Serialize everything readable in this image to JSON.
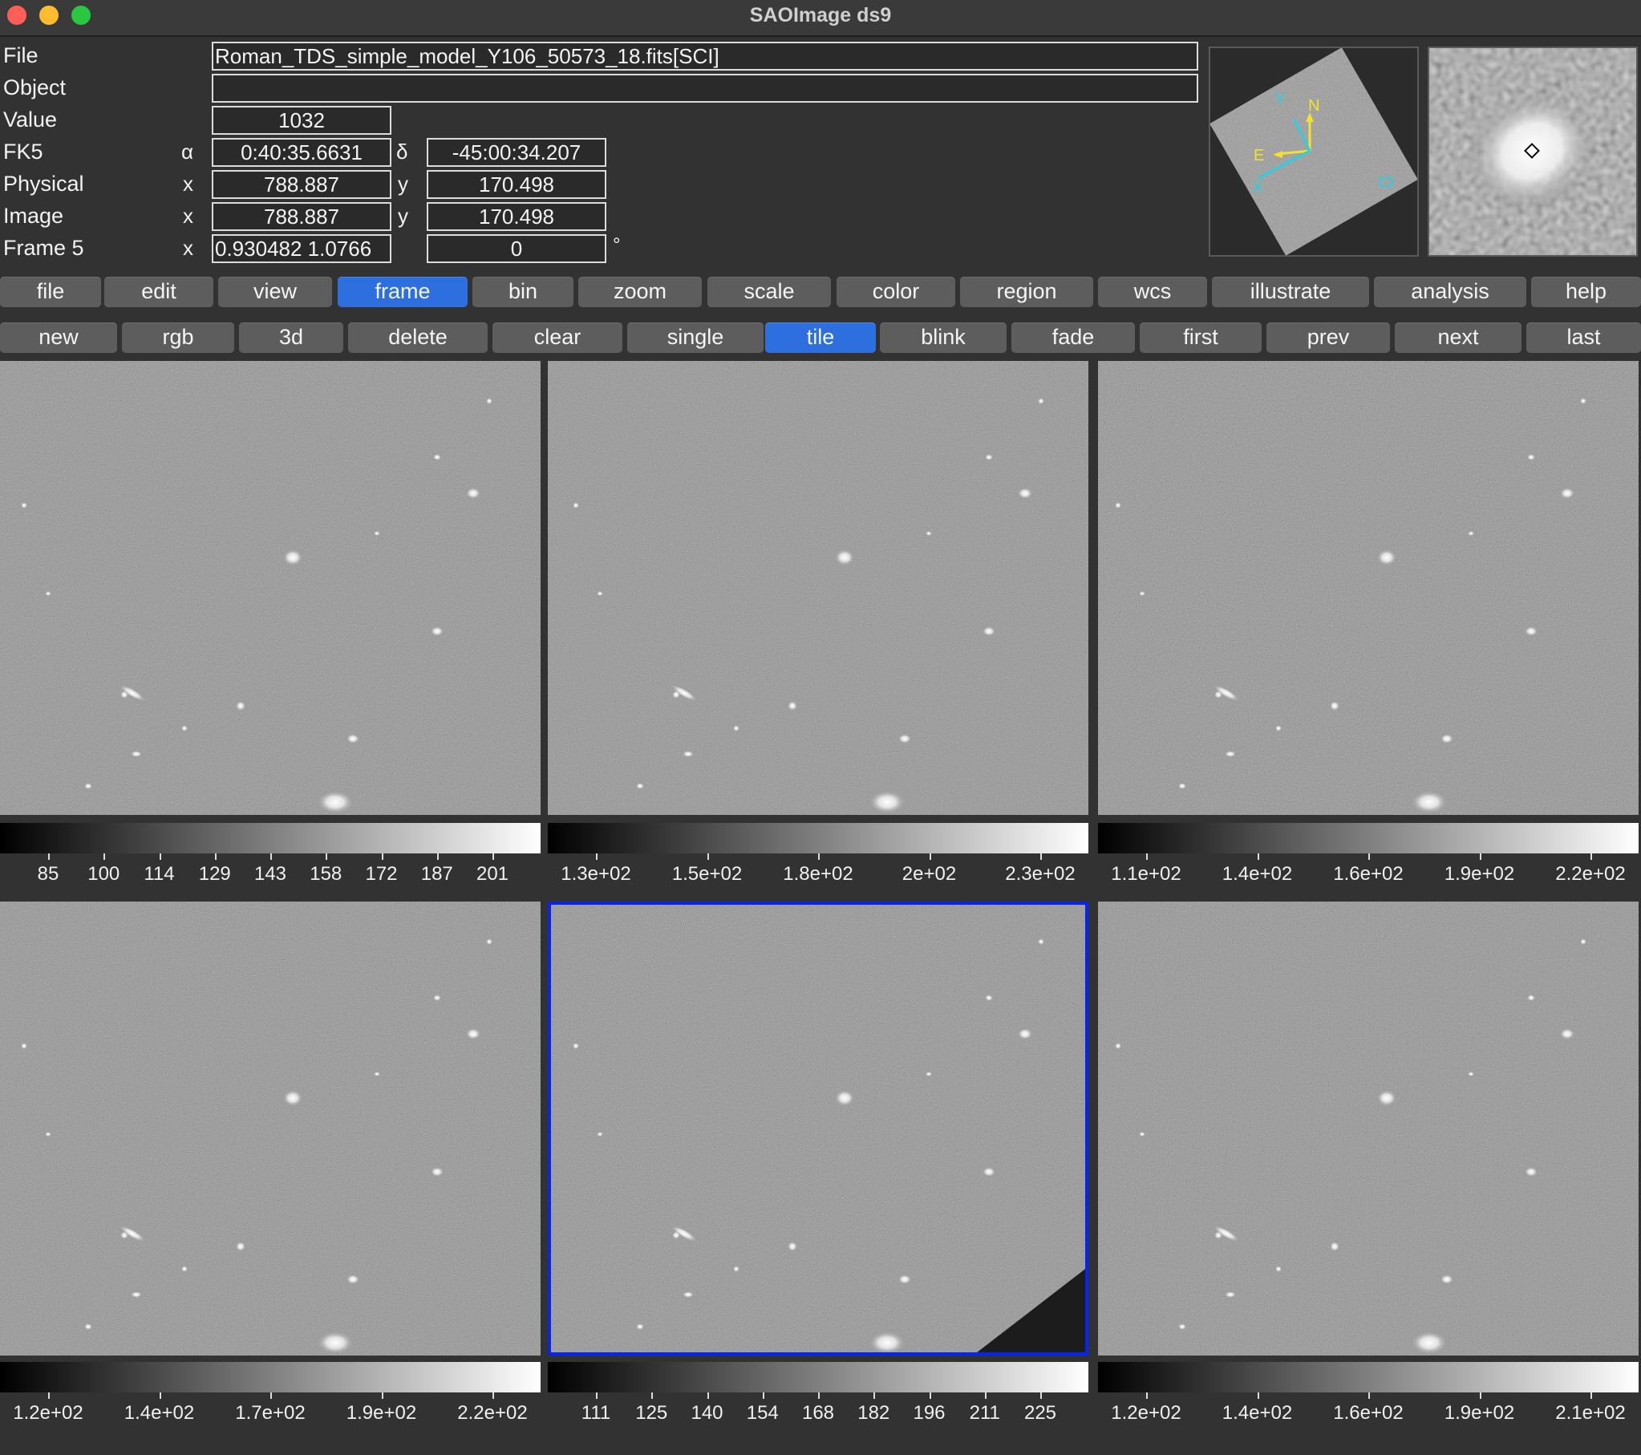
{
  "window": {
    "title": "SAOImage ds9"
  },
  "info": {
    "file_label": "File",
    "file_value": "Roman_TDS_simple_model_Y106_50573_18.fits[SCI]",
    "object_label": "Object",
    "object_value": "",
    "value_label": "Value",
    "value_value": "1032",
    "fk5_label": "FK5",
    "fk5_sym1": "α",
    "fk5_alpha": "0:40:35.6631",
    "fk5_sym2": "δ",
    "fk5_delta": "-45:00:34.207",
    "physical_label": "Physical",
    "physical_sym1": "x",
    "physical_x": "788.887",
    "physical_sym2": "y",
    "physical_y": "170.498",
    "image_label": "Image",
    "image_sym1": "x",
    "image_x": "788.887",
    "image_sym2": "y",
    "image_y": "170.498",
    "frame_label": "Frame 5",
    "frame_sym1": "x",
    "frame_zoom": "0.930482 1.0766",
    "frame_angle": "0",
    "degree_symbol": "°"
  },
  "panner": {
    "labels": {
      "n": "N",
      "e": "E",
      "x": "X",
      "y": "Y"
    }
  },
  "main_menu": [
    {
      "label": "file"
    },
    {
      "label": "edit"
    },
    {
      "label": "view"
    },
    {
      "label": "frame",
      "active": true
    },
    {
      "label": "bin"
    },
    {
      "label": "zoom"
    },
    {
      "label": "scale"
    },
    {
      "label": "color"
    },
    {
      "label": "region"
    },
    {
      "label": "wcs"
    },
    {
      "label": "illustrate"
    },
    {
      "label": "analysis"
    },
    {
      "label": "help"
    }
  ],
  "frame_menu": [
    {
      "label": "new"
    },
    {
      "label": "rgb"
    },
    {
      "label": "3d"
    },
    {
      "label": "delete"
    },
    {
      "label": "clear"
    },
    {
      "label": "single"
    },
    {
      "label": "tile",
      "active": true
    },
    {
      "label": "blink"
    },
    {
      "label": "fade"
    },
    {
      "label": "first"
    },
    {
      "label": "prev"
    },
    {
      "label": "next"
    },
    {
      "label": "last"
    }
  ],
  "frames": [
    {
      "id": 1,
      "current": false,
      "colorbar_ticks": [
        "85",
        "100",
        "114",
        "129",
        "143",
        "158",
        "172",
        "187",
        "201"
      ]
    },
    {
      "id": 2,
      "current": false,
      "colorbar_ticks": [
        "1.3e+02",
        "1.5e+02",
        "1.8e+02",
        "2e+02",
        "2.3e+02"
      ]
    },
    {
      "id": 3,
      "current": false,
      "colorbar_ticks": [
        "1.1e+02",
        "1.4e+02",
        "1.6e+02",
        "1.9e+02",
        "2.2e+02"
      ]
    },
    {
      "id": 4,
      "current": false,
      "colorbar_ticks": [
        "1.2e+02",
        "1.4e+02",
        "1.7e+02",
        "1.9e+02",
        "2.2e+02"
      ]
    },
    {
      "id": 5,
      "current": true,
      "colorbar_ticks": [
        "111",
        "125",
        "140",
        "154",
        "168",
        "182",
        "196",
        "211",
        "225"
      ]
    },
    {
      "id": 6,
      "current": false,
      "colorbar_ticks": [
        "1.2e+02",
        "1.4e+02",
        "1.6e+02",
        "1.9e+02",
        "2.1e+02"
      ]
    }
  ],
  "colors": {
    "active_button": "#2e6fe0",
    "current_frame_border": "#0a24f0",
    "panner_compass": "#f5e12a",
    "panner_axes": "#2bd0e0"
  }
}
